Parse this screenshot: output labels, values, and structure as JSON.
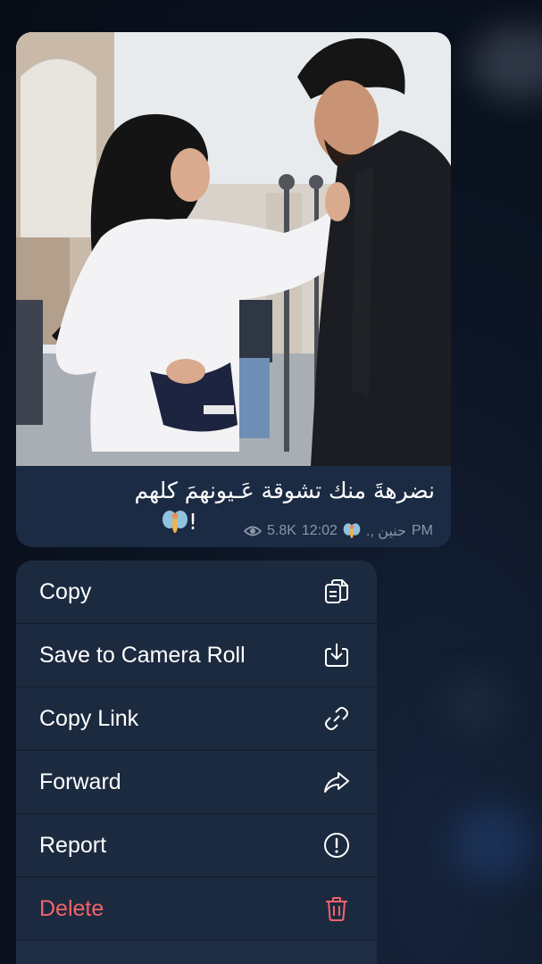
{
  "message": {
    "caption_line1": "نضرهةَ منك تشوقة عَـيونهمَ كلهم",
    "caption_line2": "!",
    "views": "5.8K",
    "time": "12:02",
    "author_fragment": "حنين ,.",
    "period": "PM"
  },
  "menu": {
    "items": [
      {
        "label": "Copy",
        "icon": "copy-icon"
      },
      {
        "label": "Save to Camera Roll",
        "icon": "download-icon"
      },
      {
        "label": "Copy Link",
        "icon": "link-icon"
      },
      {
        "label": "Forward",
        "icon": "forward-arrow-icon"
      },
      {
        "label": "Report",
        "icon": "exclamation-circle-icon"
      },
      {
        "label": "Delete",
        "icon": "trash-icon"
      }
    ]
  },
  "colors": {
    "bubble": "#1c2b44",
    "menu": "#1c2a40",
    "danger": "#f2636a",
    "meta_text": "#8b96a8"
  }
}
